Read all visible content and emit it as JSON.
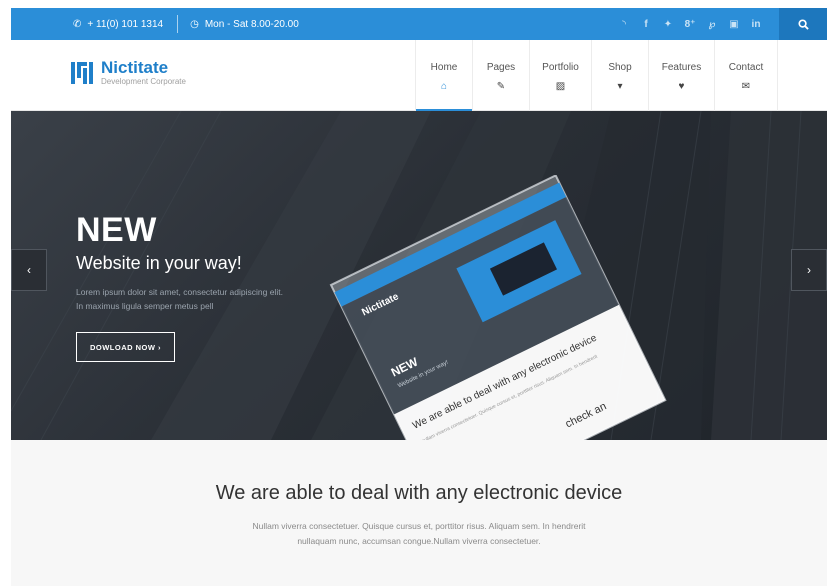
{
  "topbar": {
    "phone": "+ 11(0) 101 1314",
    "hours": "Mon - Sat 8.00-20.00",
    "social_icons": [
      "rss-icon",
      "facebook-icon",
      "twitter-icon",
      "google-plus-icon",
      "pinterest-icon",
      "instagram-icon",
      "linkedin-icon"
    ],
    "social_glyphs": [
      "◝",
      "f",
      "✦",
      "8⁺",
      "℘",
      "▣",
      "in"
    ]
  },
  "logo": {
    "name": "Nictitate",
    "tagline": "Development Corporate"
  },
  "nav": [
    {
      "label": "Home",
      "icon": "⌂",
      "active": true
    },
    {
      "label": "Pages",
      "icon": "✎"
    },
    {
      "label": "Portfolio",
      "icon": "▨"
    },
    {
      "label": "Shop",
      "icon": "▾"
    },
    {
      "label": "Features",
      "icon": "♥"
    },
    {
      "label": "Contact",
      "icon": "✉"
    }
  ],
  "hero": {
    "title": "NEW",
    "subtitle": "Website in your way!",
    "text": "Lorem ipsum dolor sit amet, consectetur adipiscing elit. In maximus ligula semper metus pell",
    "button": "DOWLOAD NOW ›",
    "device": {
      "logo": "Nictitate",
      "title": "NEW",
      "subtitle": "Website in your way!",
      "heading": "We are able to deal with any electronic device",
      "body": "Nullam viverra consectetuer. Quisque cursus et, porttitor risus. Aliquam sem. In hendrerit",
      "check": "check an"
    }
  },
  "section": {
    "title": "We are able to deal with any electronic device",
    "text": "Nullam viverra consectetuer. Quisque cursus et, porttitor risus. Aliquam sem. In hendrerit nullaquam nunc, accumsan congue.Nullam viverra consectetuer."
  },
  "colors": {
    "accent": "#2b8ed8",
    "accent_dark": "#1d77bd",
    "hero_bg": "#2a2f36"
  }
}
